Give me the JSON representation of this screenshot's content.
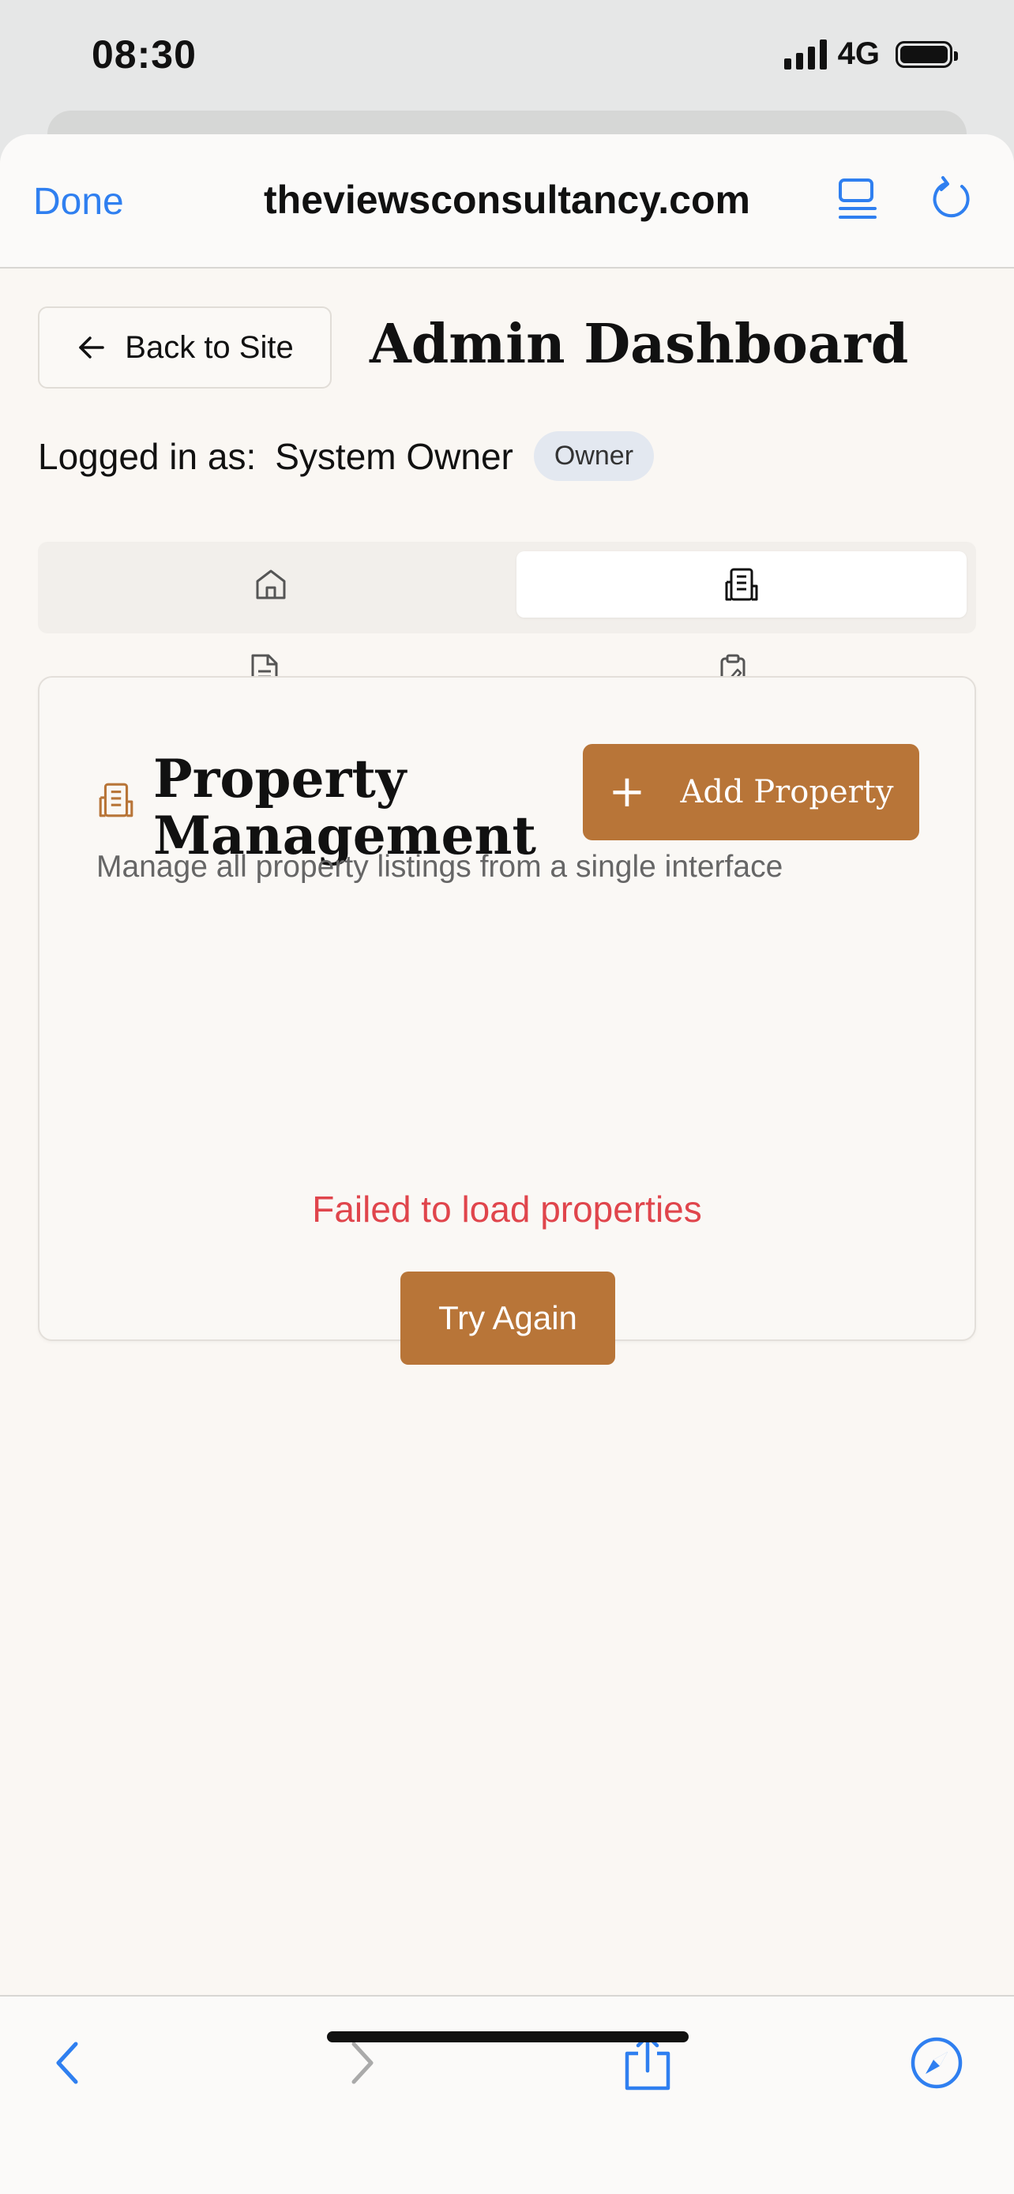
{
  "status_bar": {
    "time": "08:30",
    "network": "4G"
  },
  "browser": {
    "done_label": "Done",
    "url": "theviewsconsultancy.com",
    "accent_color": "#2f7ff0"
  },
  "header": {
    "back_label": "Back to Site",
    "title": "Admin Dashboard",
    "logged_in_label": "Logged in as:",
    "user_name": "System Owner",
    "role_badge": "Owner"
  },
  "tabs": [
    {
      "icon": "home-icon",
      "active": false
    },
    {
      "icon": "building-icon",
      "active": true
    },
    {
      "icon": "document-icon",
      "active": false
    },
    {
      "icon": "clipboard-icon",
      "active": false
    }
  ],
  "card": {
    "title": "Property Management",
    "add_button_label": "Add Property",
    "subtitle": "Manage all property listings from a single interface",
    "error_message": "Failed to load properties",
    "retry_label": "Try Again",
    "accent_color": "#b87538",
    "error_color": "#e0454c"
  }
}
